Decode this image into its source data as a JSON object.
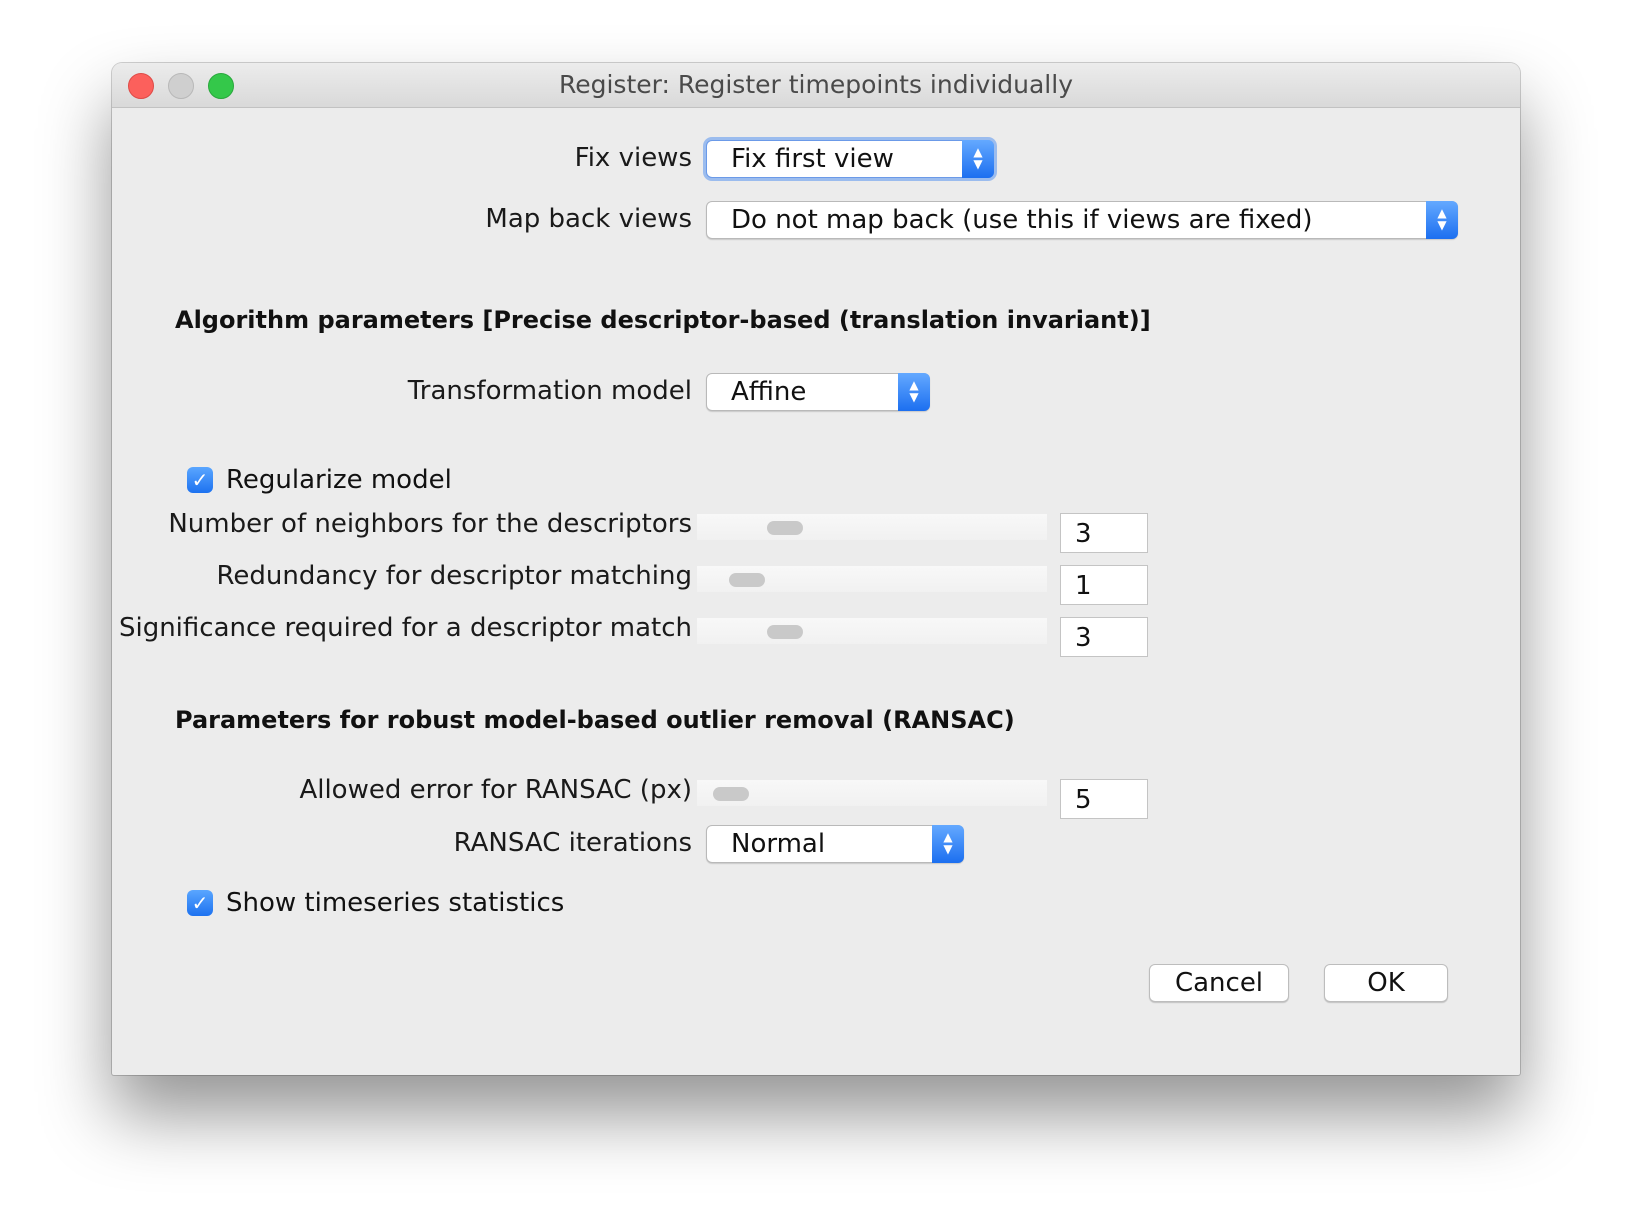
{
  "window": {
    "title": "Register: Register timepoints individually"
  },
  "fix_views": {
    "label": "Fix views",
    "value": "Fix first view"
  },
  "map_back_views": {
    "label": "Map back views",
    "value": "Do not map back (use this if views are fixed)"
  },
  "algorithm_section": {
    "title": "Algorithm parameters [Precise descriptor-based (translation invariant)]"
  },
  "transformation_model": {
    "label": "Transformation model",
    "value": "Affine"
  },
  "regularize_model": {
    "label": "Regularize model",
    "checked": true
  },
  "num_neighbors": {
    "label": "Number of neighbors for the descriptors",
    "value": "3"
  },
  "redundancy": {
    "label": "Redundancy for descriptor matching",
    "value": "1"
  },
  "significance": {
    "label": "Significance required for a descriptor match",
    "value": "3"
  },
  "ransac_section": {
    "title": "Parameters for robust model-based outlier removal (RANSAC)"
  },
  "allowed_error": {
    "label": "Allowed error for RANSAC (px)",
    "value": "5"
  },
  "ransac_iterations": {
    "label": "RANSAC iterations",
    "value": "Normal"
  },
  "show_statistics": {
    "label": "Show timeseries statistics",
    "checked": true
  },
  "buttons": {
    "cancel": "Cancel",
    "ok": "OK"
  },
  "icons": {
    "checkmark": "✓",
    "dropdown_arrows": "up-down-chevron-icon"
  },
  "colors": {
    "accent_blue": "#1c6ff0",
    "close_red": "#fc605c",
    "maximize_green": "#34c84a"
  }
}
